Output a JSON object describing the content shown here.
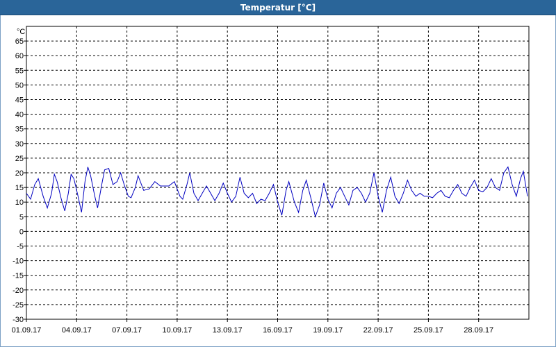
{
  "window": {
    "title": "Temperatur [°C]"
  },
  "chart_data": {
    "type": "line",
    "title": "Temperatur [°C]",
    "ylabel": "°C",
    "xlabel": "",
    "ylim": [
      -30,
      70
    ],
    "xlim": [
      "2017-09-01",
      "2017-09-30"
    ],
    "yticks": [
      65,
      60,
      55,
      50,
      45,
      40,
      35,
      30,
      25,
      20,
      15,
      10,
      5,
      0,
      -5,
      -10,
      -15,
      -20,
      -25,
      -30
    ],
    "xticks": [
      "01.09.17",
      "04.09.17",
      "07.09.17",
      "10.09.17",
      "13.09.17",
      "16.09.17",
      "19.09.17",
      "22.09.17",
      "25.09.17",
      "28.09.17"
    ],
    "grid": true,
    "legend": "none",
    "series": [
      {
        "color": "#0000c0",
        "points": [
          [
            "2017-09-01 00:00",
            13
          ],
          [
            "2017-09-01 06:00",
            11
          ],
          [
            "2017-09-01 12:00",
            16
          ],
          [
            "2017-09-01 17:00",
            18
          ],
          [
            "2017-09-02 00:00",
            12
          ],
          [
            "2017-09-02 06:00",
            8
          ],
          [
            "2017-09-02 12:00",
            13
          ],
          [
            "2017-09-02 16:00",
            19.5
          ],
          [
            "2017-09-02 20:00",
            17
          ],
          [
            "2017-09-03 02:00",
            11
          ],
          [
            "2017-09-03 07:00",
            7
          ],
          [
            "2017-09-03 12:00",
            13
          ],
          [
            "2017-09-03 16:00",
            19.5
          ],
          [
            "2017-09-03 20:00",
            18
          ],
          [
            "2017-09-04 02:00",
            12
          ],
          [
            "2017-09-04 07:00",
            6.5
          ],
          [
            "2017-09-04 12:00",
            17
          ],
          [
            "2017-09-04 16:00",
            22
          ],
          [
            "2017-09-04 20:00",
            19
          ],
          [
            "2017-09-05 02:00",
            12
          ],
          [
            "2017-09-05 06:00",
            8
          ],
          [
            "2017-09-05 12:00",
            16
          ],
          [
            "2017-09-05 16:00",
            21
          ],
          [
            "2017-09-05 22:00",
            21.5
          ],
          [
            "2017-09-06 04:00",
            16
          ],
          [
            "2017-09-06 10:00",
            17
          ],
          [
            "2017-09-06 15:00",
            20
          ],
          [
            "2017-09-06 20:00",
            16
          ],
          [
            "2017-09-07 02:00",
            12
          ],
          [
            "2017-09-07 06:00",
            11.5
          ],
          [
            "2017-09-07 12:00",
            15
          ],
          [
            "2017-09-07 16:00",
            19
          ],
          [
            "2017-09-08 00:00",
            14
          ],
          [
            "2017-09-08 08:00",
            14.5
          ],
          [
            "2017-09-08 16:00",
            17
          ],
          [
            "2017-09-09 00:00",
            15.5
          ],
          [
            "2017-09-09 12:00",
            15.5
          ],
          [
            "2017-09-09 20:00",
            17
          ],
          [
            "2017-09-10 04:00",
            12
          ],
          [
            "2017-09-10 08:00",
            11
          ],
          [
            "2017-09-10 14:00",
            16
          ],
          [
            "2017-09-10 18:00",
            20
          ],
          [
            "2017-09-11 00:00",
            13
          ],
          [
            "2017-09-11 06:00",
            10.5
          ],
          [
            "2017-09-11 12:00",
            13
          ],
          [
            "2017-09-11 18:00",
            15.5
          ],
          [
            "2017-09-12 00:00",
            13
          ],
          [
            "2017-09-12 06:00",
            10.5
          ],
          [
            "2017-09-12 12:00",
            13
          ],
          [
            "2017-09-12 18:00",
            16.5
          ],
          [
            "2017-09-13 00:00",
            13
          ],
          [
            "2017-09-13 06:00",
            10
          ],
          [
            "2017-09-13 12:00",
            12
          ],
          [
            "2017-09-13 18:00",
            18.5
          ],
          [
            "2017-09-14 00:00",
            13
          ],
          [
            "2017-09-14 06:00",
            11.5
          ],
          [
            "2017-09-14 12:00",
            13
          ],
          [
            "2017-09-14 18:00",
            9.5
          ],
          [
            "2017-09-15 00:00",
            11
          ],
          [
            "2017-09-15 06:00",
            10.5
          ],
          [
            "2017-09-15 12:00",
            13
          ],
          [
            "2017-09-15 18:00",
            16
          ],
          [
            "2017-09-16 00:00",
            10
          ],
          [
            "2017-09-16 06:00",
            5.5
          ],
          [
            "2017-09-16 12:00",
            14
          ],
          [
            "2017-09-16 16:00",
            17
          ],
          [
            "2017-09-17 00:00",
            10
          ],
          [
            "2017-09-17 06:00",
            6.5
          ],
          [
            "2017-09-17 12:00",
            14
          ],
          [
            "2017-09-17 17:00",
            17.5
          ],
          [
            "2017-09-18 00:00",
            11
          ],
          [
            "2017-09-18 06:00",
            5
          ],
          [
            "2017-09-18 12:00",
            9
          ],
          [
            "2017-09-18 18:00",
            16.5
          ],
          [
            "2017-09-19 00:00",
            11
          ],
          [
            "2017-09-19 06:00",
            8
          ],
          [
            "2017-09-19 12:00",
            13
          ],
          [
            "2017-09-19 18:00",
            15
          ],
          [
            "2017-09-20 00:00",
            12
          ],
          [
            "2017-09-20 06:00",
            9
          ],
          [
            "2017-09-20 12:00",
            14
          ],
          [
            "2017-09-20 18:00",
            15
          ],
          [
            "2017-09-21 00:00",
            13
          ],
          [
            "2017-09-21 06:00",
            10
          ],
          [
            "2017-09-21 12:00",
            13
          ],
          [
            "2017-09-21 18:00",
            20
          ],
          [
            "2017-09-22 00:00",
            12
          ],
          [
            "2017-09-22 06:00",
            6.5
          ],
          [
            "2017-09-22 12:00",
            14
          ],
          [
            "2017-09-22 18:00",
            18.5
          ],
          [
            "2017-09-23 00:00",
            12
          ],
          [
            "2017-09-23 06:00",
            9.5
          ],
          [
            "2017-09-23 12:00",
            13
          ],
          [
            "2017-09-23 18:00",
            17.5
          ],
          [
            "2017-09-24 00:00",
            14
          ],
          [
            "2017-09-24 06:00",
            12
          ],
          [
            "2017-09-24 12:00",
            13
          ],
          [
            "2017-09-24 18:00",
            12
          ],
          [
            "2017-09-25 00:00",
            12
          ],
          [
            "2017-09-25 06:00",
            11.5
          ],
          [
            "2017-09-25 12:00",
            13
          ],
          [
            "2017-09-25 18:00",
            14
          ],
          [
            "2017-09-26 00:00",
            12
          ],
          [
            "2017-09-26 06:00",
            11.5
          ],
          [
            "2017-09-26 12:00",
            14
          ],
          [
            "2017-09-26 18:00",
            16
          ],
          [
            "2017-09-27 00:00",
            13
          ],
          [
            "2017-09-27 06:00",
            12
          ],
          [
            "2017-09-27 12:00",
            15
          ],
          [
            "2017-09-27 18:00",
            17.5
          ],
          [
            "2017-09-28 00:00",
            14
          ],
          [
            "2017-09-28 06:00",
            13.5
          ],
          [
            "2017-09-28 12:00",
            15
          ],
          [
            "2017-09-28 18:00",
            18
          ],
          [
            "2017-09-29 00:00",
            15
          ],
          [
            "2017-09-29 06:00",
            14
          ],
          [
            "2017-09-29 12:00",
            20
          ],
          [
            "2017-09-29 18:00",
            22
          ],
          [
            "2017-09-30 00:00",
            16
          ],
          [
            "2017-09-30 06:00",
            12
          ],
          [
            "2017-09-30 12:00",
            18
          ],
          [
            "2017-09-30 16:00",
            20.5
          ],
          [
            "2017-09-30 22:00",
            12
          ]
        ]
      }
    ]
  }
}
